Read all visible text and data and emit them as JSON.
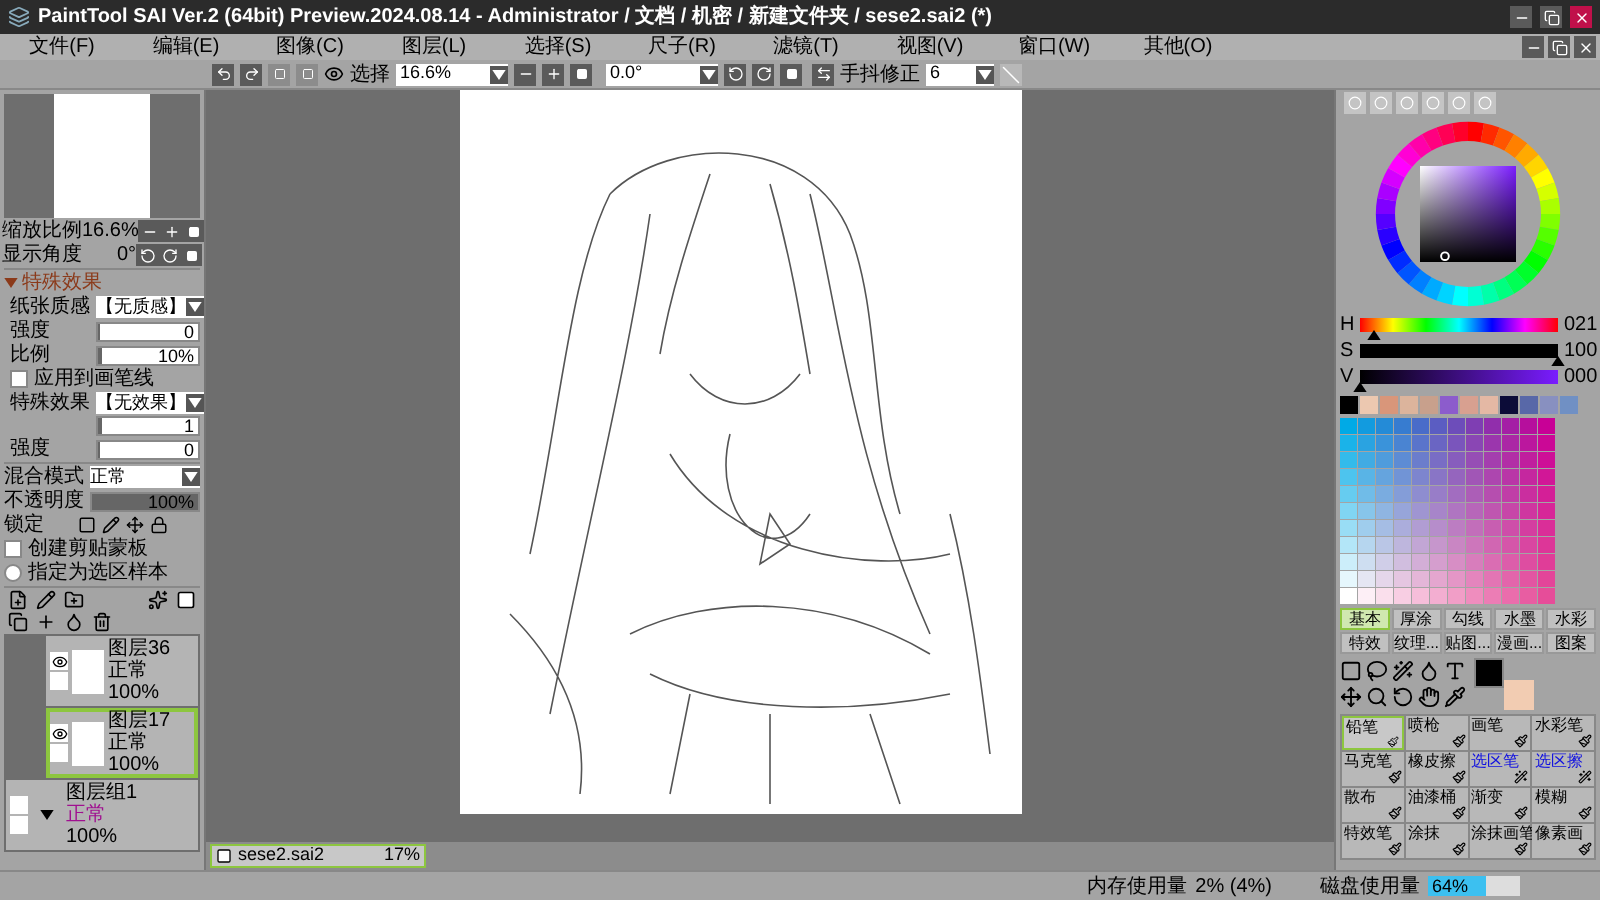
{
  "window": {
    "title": "PaintTool SAI Ver.2 (64bit) Preview.2024.08.14 - Administrator / 文档 / 机密 / 新建文件夹 / sese2.sai2 (*)"
  },
  "menu": [
    "文件(F)",
    "编辑(E)",
    "图像(C)",
    "图层(L)",
    "选择(S)",
    "尺子(R)",
    "滤镜(T)",
    "视图(V)",
    "窗口(W)",
    "其他(O)"
  ],
  "toolbar": {
    "selection_label": "选择",
    "zoom": "16.6%",
    "angle": "0.0°",
    "stabilizer_label": "手抖修正",
    "stabilizer": "6"
  },
  "navigator": {
    "zoom_label": "缩放比例",
    "zoom": "16.6%",
    "angle_label": "显示角度",
    "angle": "0°"
  },
  "effects": {
    "title": "特殊效果",
    "expanded": true,
    "rows": [
      {
        "kind": "select",
        "label": "纸张质感",
        "value": "【无质感】"
      },
      {
        "kind": "number",
        "label": "强度",
        "value": "0",
        "level": 0
      },
      {
        "kind": "number",
        "label": "比例",
        "value": "10%",
        "level": 0.03
      },
      {
        "kind": "check",
        "label": "应用到画笔线",
        "checked": false
      },
      {
        "kind": "select",
        "label": "特殊效果",
        "value": "【无效果】"
      },
      {
        "kind": "number",
        "value": "1",
        "level": 0.03
      },
      {
        "kind": "number",
        "label": "强度",
        "value": "0",
        "level": 0
      }
    ]
  },
  "layer_props": {
    "blend_label": "混合模式",
    "blend": "正常",
    "opacity": {
      "label": "不透明度",
      "value": "100%",
      "level": 1
    },
    "lock_label": "锁定",
    "clip": {
      "label": "创建剪贴蒙板",
      "checked": false
    },
    "sample": {
      "label": "指定为选区样本",
      "selected": false
    }
  },
  "layers": [
    {
      "kind": "layer",
      "name": "图层36",
      "mode": "正常",
      "opacity": "100%",
      "visible": true,
      "selected": false
    },
    {
      "kind": "layer",
      "name": "图层17",
      "mode": "正常",
      "opacity": "100%",
      "visible": true,
      "selected": true
    },
    {
      "kind": "group",
      "name": "图层组1",
      "mode": "正常",
      "opacity": "100%",
      "visible": false,
      "selected": false
    }
  ],
  "file_tabs": [
    {
      "name": "sese2.sai2",
      "zoom": "17%",
      "selected": true
    }
  ],
  "colors": {
    "hsv": [
      {
        "label": "H",
        "value": "021",
        "level": 0.07
      },
      {
        "label": "S",
        "value": "100",
        "level": 1
      },
      {
        "label": "V",
        "value": "000",
        "level": 0
      }
    ],
    "swatches": [
      {
        "color": "#000000"
      },
      {
        "color": "#ecc8b0"
      },
      {
        "color": "#d9967a"
      },
      {
        "color": "#dcb49c"
      },
      {
        "color": "#c8a08c"
      },
      {
        "color": "#8c5ccc"
      },
      {
        "color": "#d8a090"
      },
      {
        "color": "#e4b8a4"
      },
      {
        "color": "#0c0c38"
      },
      {
        "color": "#5868a8"
      },
      {
        "color": "#8890c0"
      },
      {
        "color": "#7090c4"
      }
    ],
    "current": [
      {
        "color": "#000000"
      },
      {
        "color": "#f2ccb2"
      }
    ]
  },
  "brush_tabs": [
    {
      "label": "基本",
      "selected": true
    },
    {
      "label": "厚涂",
      "selected": false
    },
    {
      "label": "勾线",
      "selected": false
    },
    {
      "label": "水墨",
      "selected": false
    },
    {
      "label": "水彩",
      "selected": false
    },
    {
      "label": "特效",
      "selected": false
    },
    {
      "label": "纹理...",
      "selected": false
    },
    {
      "label": "贴图...",
      "selected": false
    },
    {
      "label": "漫画...",
      "selected": false
    },
    {
      "label": "图案",
      "selected": false
    }
  ],
  "brushes": [
    {
      "label": "铅笔",
      "kind": "brush",
      "selected": true
    },
    {
      "label": "喷枪",
      "kind": "brush",
      "selected": false
    },
    {
      "label": "画笔",
      "kind": "brush",
      "selected": false
    },
    {
      "label": "水彩笔",
      "kind": "brush",
      "selected": false
    },
    {
      "label": "马克笔",
      "kind": "brush",
      "selected": false
    },
    {
      "label": "橡皮擦",
      "kind": "brush",
      "selected": false
    },
    {
      "label": "选区笔",
      "kind": "selection",
      "selected": false
    },
    {
      "label": "选区擦",
      "kind": "selection",
      "selected": false
    },
    {
      "label": "散布",
      "kind": "brush",
      "selected": false
    },
    {
      "label": "油漆桶",
      "kind": "brush",
      "selected": false
    },
    {
      "label": "渐变",
      "kind": "brush",
      "selected": false
    },
    {
      "label": "模糊",
      "kind": "brush",
      "selected": false
    },
    {
      "label": "特效笔",
      "kind": "brush",
      "selected": false
    },
    {
      "label": "涂抹",
      "kind": "brush",
      "selected": false
    },
    {
      "label": "涂抹画笔",
      "kind": "brush",
      "selected": false
    },
    {
      "label": "像素画",
      "kind": "brush",
      "selected": false
    }
  ],
  "status": {
    "memory_label": "内存使用量",
    "memory": "2% (4%)",
    "disk": {
      "label": "磁盘使用量",
      "value": "64%",
      "level": 0.64
    }
  }
}
